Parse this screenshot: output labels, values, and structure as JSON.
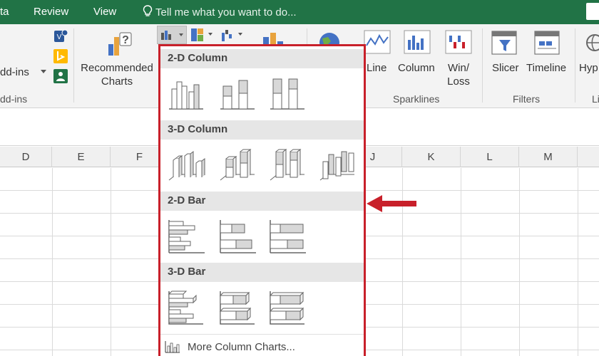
{
  "tabs": [
    {
      "label": "ta"
    },
    {
      "label": "Review"
    },
    {
      "label": "View"
    }
  ],
  "tellme": {
    "text": "Tell me what you want to do..."
  },
  "ribbon": {
    "addins_button": "dd-ins",
    "addins_group": "dd-ins",
    "recommended_charts": [
      "Recommended",
      "Charts"
    ],
    "sparklines": {
      "line": "Line",
      "column": "Column",
      "winloss": [
        "Win/",
        "Loss"
      ],
      "group": "Sparklines"
    },
    "filters": {
      "slicer": "Slicer",
      "timeline": "Timeline",
      "group": "Filters"
    },
    "hyperlink": "Hyp",
    "links_group": "Li"
  },
  "columns": [
    "D",
    "E",
    "F",
    "J",
    "K",
    "L",
    "M"
  ],
  "dropdown": {
    "sections": [
      {
        "title": "2-D Column",
        "options": [
          "Clustered Column",
          "Stacked Column",
          "100% Stacked Column"
        ]
      },
      {
        "title": "3-D Column",
        "options": [
          "3-D Clustered Column",
          "3-D Stacked Column",
          "3-D 100% Stacked Column",
          "3-D Column"
        ]
      },
      {
        "title": "2-D Bar",
        "options": [
          "Clustered Bar",
          "Stacked Bar",
          "100% Stacked Bar"
        ]
      },
      {
        "title": "3-D Bar",
        "options": [
          "3-D Clustered Bar",
          "3-D Stacked Bar",
          "3-D 100% Stacked Bar"
        ]
      }
    ],
    "more": "More Column Charts..."
  },
  "colors": {
    "ribbon_green": "#217346",
    "highlight": "#c8202a"
  }
}
